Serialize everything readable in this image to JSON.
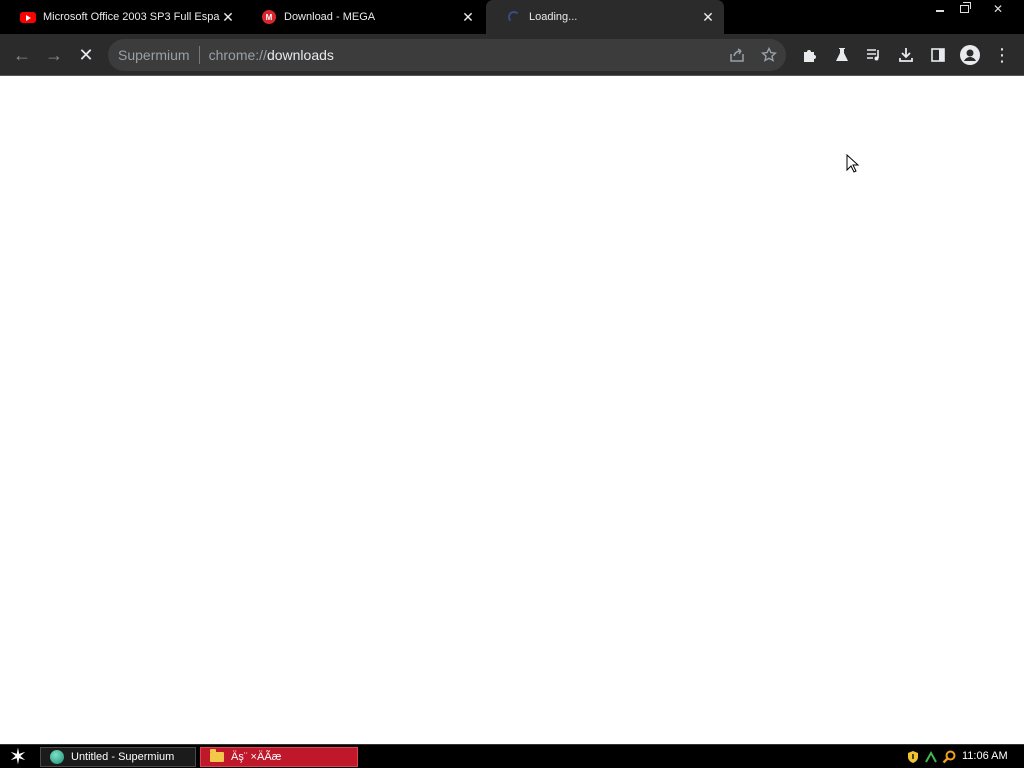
{
  "tabs": [
    {
      "title": "Microsoft Office 2003 SP3 Full Espa",
      "favicon": "youtube-icon",
      "active": false
    },
    {
      "title": "Download - MEGA",
      "favicon": "mega-icon",
      "active": false
    },
    {
      "title": "Loading...",
      "favicon": "loading-spinner-icon",
      "active": true
    }
  ],
  "tab_close_glyph": "✕",
  "window_controls": {
    "close_glyph": "✕"
  },
  "toolbar": {
    "back_glyph": "←",
    "forward_glyph": "→",
    "stop_glyph": "✕",
    "menu_glyph": "⋮"
  },
  "omnibox": {
    "origin": "Supermium",
    "url_scheme": "chrome://",
    "url_path": "downloads"
  },
  "taskbar": {
    "start_glyph": "✶",
    "items": [
      {
        "label": "Untitled - Supermium",
        "icon": "browser-globe-icon"
      },
      {
        "label": "Äş¨ ×ÄÃæ",
        "icon": "folder-icon"
      }
    ],
    "tray_icons": [
      "security-shield-icon",
      "network-icon",
      "search-icon"
    ],
    "clock": "11:06 AM"
  },
  "colors": {
    "tabstrip_bg": "#000000",
    "toolbar_bg": "#2b2b2b",
    "omnibox_bg": "#3c3c3c",
    "taskbar_active_item": "#c0182b"
  }
}
